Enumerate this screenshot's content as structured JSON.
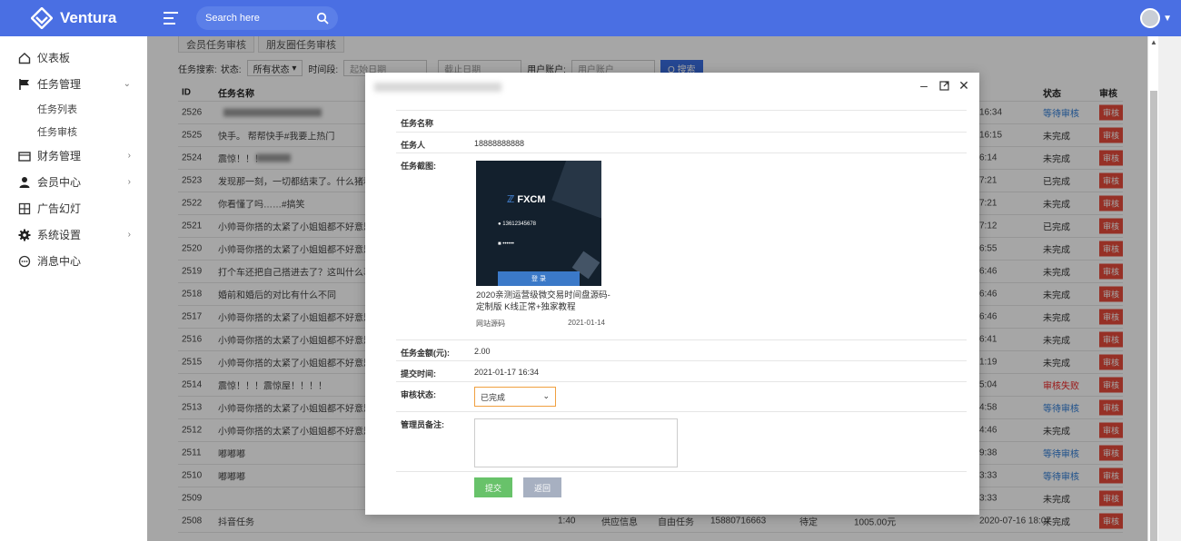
{
  "topbar": {
    "brand": "Ventura",
    "search_placeholder": "Search here"
  },
  "sidebar": {
    "items": [
      {
        "label": "仪表板",
        "icon": "home-icon"
      },
      {
        "label": "任务管理",
        "icon": "flag-icon",
        "expanded": true,
        "children": [
          "任务列表",
          "任务审核"
        ]
      },
      {
        "label": "财务管理",
        "icon": "wallet-icon"
      },
      {
        "label": "会员中心",
        "icon": "user-icon"
      },
      {
        "label": "广告幻灯",
        "icon": "grid-icon"
      },
      {
        "label": "系统设置",
        "icon": "gear-icon"
      },
      {
        "label": "消息中心",
        "icon": "chat-icon"
      }
    ]
  },
  "content": {
    "tabs": [
      "会员任务审核",
      "朋友圈任务审核"
    ],
    "filter": {
      "label": "任务搜索:",
      "status_label": "状态:",
      "status_value": "所有状态",
      "time_label": "时间段:",
      "start_placeholder": "起始日期",
      "end_placeholder": "截止日期",
      "account_label": "用户账户:",
      "account_placeholder": "用户账户",
      "search_button": "Q 搜索"
    },
    "table": {
      "headers": [
        "ID",
        "任务名称",
        "状态",
        "审核"
      ],
      "op_label": "审核",
      "rows": [
        {
          "id": "2526",
          "name": "",
          "time": "16:34",
          "status": "等待审核"
        },
        {
          "id": "2525",
          "name": "快手。 帮帮快手#我要上热门",
          "time": "16:15",
          "status": "未完成"
        },
        {
          "id": "2524",
          "name": "震惊！！！",
          "time": "6:14",
          "status": "未完成"
        },
        {
          "id": "2523",
          "name": "发现那一刻，一切都结束了。什么猪和狗都写",
          "time": "7:21",
          "status": "已完成"
        },
        {
          "id": "2522",
          "name": "你看懂了吗……#搞笑",
          "time": "7:21",
          "status": "未完成"
        },
        {
          "id": "2521",
          "name": "小帅哥你搭的太紧了小姐姐都不好意思了",
          "time": "7:12",
          "status": "已完成"
        },
        {
          "id": "2520",
          "name": "小帅哥你搭的太紧了小姐姐都不好意思了",
          "time": "6:55",
          "status": "未完成"
        },
        {
          "id": "2519",
          "name": "打个车还把自己搭进去了？这叫什么事啊……",
          "time": "6:46",
          "status": "未完成"
        },
        {
          "id": "2518",
          "name": "婚前和婚后的对比有什么不同",
          "time": "6:46",
          "status": "未完成"
        },
        {
          "id": "2517",
          "name": "小帅哥你搭的太紧了小姐姐都不好意思了",
          "time": "6:46",
          "status": "未完成"
        },
        {
          "id": "2516",
          "name": "小帅哥你搭的太紧了小姐姐都不好意思了",
          "time": "6:41",
          "status": "未完成"
        },
        {
          "id": "2515",
          "name": "小帅哥你搭的太紧了小姐姐都不好意思了",
          "time": "1:19",
          "status": "未完成"
        },
        {
          "id": "2514",
          "name": "震惊！！！震惊屋！！！！",
          "time": "5:04",
          "status": "审核失败"
        },
        {
          "id": "2513",
          "name": "小帅哥你搭的太紧了小姐姐都不好意思了",
          "time": "4:58",
          "status": "等待审核"
        },
        {
          "id": "2512",
          "name": "小帅哥你搭的太紧了小姐姐都不好意思了",
          "time": "4:46",
          "status": "未完成"
        },
        {
          "id": "2511",
          "name": "嘟嘟嘟",
          "time": "9:38",
          "status": "等待审核"
        },
        {
          "id": "2510",
          "name": "嘟嘟嘟",
          "time": "3:33",
          "status": "等待审核"
        },
        {
          "id": "2509",
          "name": "",
          "time": "3:33",
          "status": "未完成"
        },
        {
          "id": "2508",
          "name": "抖音任务",
          "x1": "1:40",
          "x2": "供应信息",
          "x3": "自由任务",
          "x4": "15880716663",
          "x5": "待定",
          "x6": "1005.00元",
          "time": "2020-07-16 18:07",
          "status": "未完成"
        }
      ]
    }
  },
  "modal": {
    "fields": {
      "task_name_label": "任务名称",
      "task_user_label": "任务人",
      "task_user_value": "18888888888",
      "screenshot_label": "任务截图:",
      "screenshot_phone": "13612345678",
      "screenshot_password": "••••••",
      "screenshot_login": "登 录",
      "screenshot_logo": "FXCM",
      "screenshot_caption": "2020亲测运营级微交易时间盘源码-定制版 K线正常+独家教程",
      "screenshot_source": "网站源码",
      "screenshot_date": "2021-01-14",
      "amount_label": "任务金额(元):",
      "amount_value": "2.00",
      "submit_time_label": "提交时间:",
      "submit_time_value": "2021-01-17 16:34",
      "review_status_label": "审核状态:",
      "review_status_value": "已完成",
      "admin_note_label": "管理员备注:"
    },
    "buttons": {
      "submit": "提交",
      "back": "返回"
    }
  }
}
